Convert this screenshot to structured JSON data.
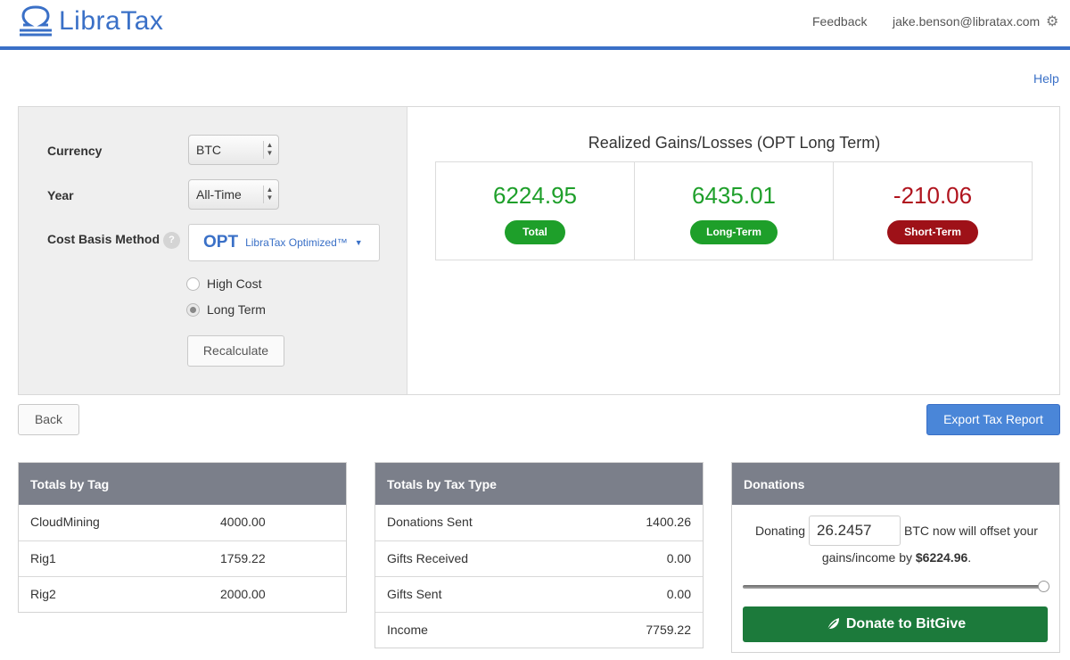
{
  "header": {
    "brand": "LibraTax",
    "feedback": "Feedback",
    "user_email": "jake.benson@libratax.com"
  },
  "help": "Help",
  "settings": {
    "currency_label": "Currency",
    "currency_value": "BTC",
    "year_label": "Year",
    "year_value": "All-Time",
    "cost_basis_label": "Cost Basis Method",
    "cost_basis_help": "?",
    "cost_basis_code": "OPT",
    "cost_basis_name": "LibraTax Optimized™",
    "options": [
      {
        "label": "High Cost",
        "selected": false
      },
      {
        "label": "Long Term",
        "selected": true
      }
    ],
    "recalculate": "Recalculate"
  },
  "gains": {
    "title": "Realized Gains/Losses (OPT Long Term)",
    "total_value": "6224.95",
    "total_label": "Total",
    "long_value": "6435.01",
    "long_label": "Long-Term",
    "short_value": "-210.06",
    "short_label": "Short-Term",
    "colors": {
      "positive": "#1e9f2a",
      "negative": "#b0141e"
    }
  },
  "actions": {
    "back": "Back",
    "export": "Export Tax Report"
  },
  "totals_by_tag": {
    "title": "Totals by Tag",
    "rows": [
      {
        "name": "CloudMining",
        "value": "4000.00"
      },
      {
        "name": "Rig1",
        "value": "1759.22"
      },
      {
        "name": "Rig2",
        "value": "2000.00"
      }
    ]
  },
  "totals_by_tax_type": {
    "title": "Totals by Tax Type",
    "rows": [
      {
        "name": "Donations Sent",
        "value": "1400.26"
      },
      {
        "name": "Gifts Received",
        "value": "0.00"
      },
      {
        "name": "Gifts Sent",
        "value": "0.00"
      },
      {
        "name": "Income",
        "value": "7759.22"
      }
    ]
  },
  "donations": {
    "title": "Donations",
    "prefix": "Donating",
    "amount": "26.2457",
    "suffix": "BTC now will offset your",
    "line2_prefix": "gains/income by ",
    "line2_amount": "$6224.96",
    "line2_suffix": ".",
    "slider_fraction": 1.0,
    "button": "Donate to BitGive"
  }
}
